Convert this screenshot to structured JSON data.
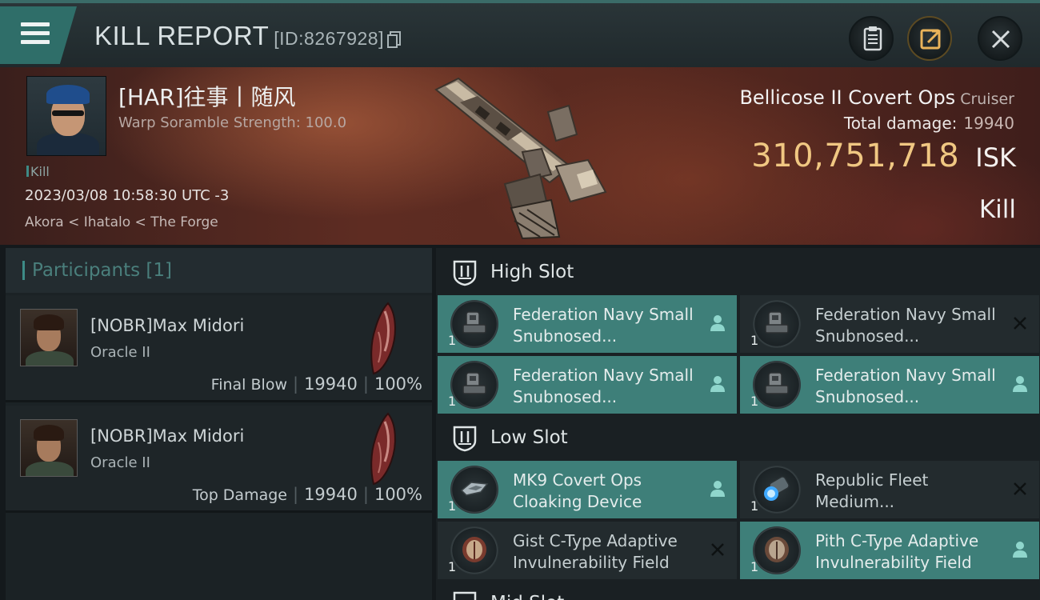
{
  "header": {
    "title": "KILL REPORT",
    "report_id": "[ID:8267928]"
  },
  "victim": {
    "name": "[HAR]往事丨随风",
    "warp_scramble": "Warp Soramble Strength: 100.0",
    "kill_count": "Kill",
    "datetime": "2023/03/08 10:58:30 UTC -3",
    "location": "Akora < Ihatalo < The Forge",
    "ship_name": "Bellicose II Covert Ops",
    "ship_class": "Cruiser",
    "total_damage_label": "Total damage:",
    "total_damage_value": "19940",
    "isk_value": "310,751,718",
    "isk_unit": "ISK",
    "result_label": "Kill"
  },
  "participants": {
    "title": "Participants [1]",
    "rows": [
      {
        "name": "[NOBR]Max Midori",
        "ship": "Oracle II",
        "role": "Final Blow",
        "damage": "19940",
        "percent": "100%"
      },
      {
        "name": "[NOBR]Max Midori",
        "ship": "Oracle II",
        "role": "Top Damage",
        "damage": "19940",
        "percent": "100%"
      }
    ]
  },
  "fitting": {
    "high_slot_label": "High Slot",
    "low_slot_label": "Low Slot",
    "mid_slot_label": "Mid Slot",
    "high_modules": [
      {
        "qty": "1",
        "name": "Federation Navy Small Snubnosed...",
        "state": "fitted",
        "status_icon": "pilot-icon"
      },
      {
        "qty": "1",
        "name": "Federation Navy Small Snubnosed...",
        "state": "destroyed",
        "status_icon": "close-x-icon"
      },
      {
        "qty": "1",
        "name": "Federation Navy Small Snubnosed...",
        "state": "fitted",
        "status_icon": "pilot-icon"
      },
      {
        "qty": "1",
        "name": "Federation Navy Small Snubnosed...",
        "state": "fitted",
        "status_icon": "pilot-icon"
      }
    ],
    "low_modules": [
      {
        "qty": "1",
        "name": "MK9 Covert Ops Cloaking Device",
        "state": "fitted",
        "status_icon": "pilot-icon"
      },
      {
        "qty": "1",
        "name": "Republic Fleet Medium...",
        "state": "destroyed",
        "status_icon": "close-x-icon"
      },
      {
        "qty": "1",
        "name": "Gist C-Type Adaptive Invulnerability Field",
        "state": "destroyed",
        "status_icon": "close-x-icon"
      },
      {
        "qty": "1",
        "name": "Pith C-Type Adaptive Invulnerability Field",
        "state": "fitted",
        "status_icon": "pilot-icon"
      }
    ]
  },
  "colors": {
    "accent_teal": "#3e7f79",
    "isk_gold": "#f0c782",
    "hero_red": "#5e2c22"
  }
}
